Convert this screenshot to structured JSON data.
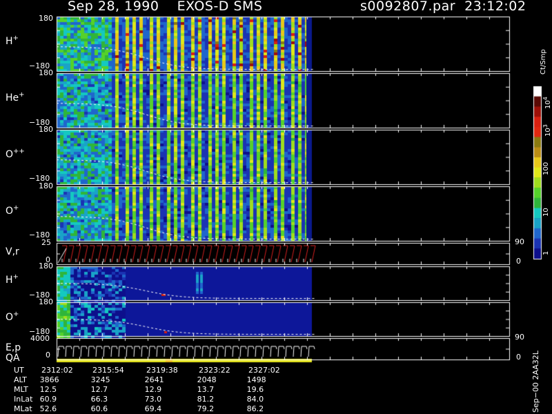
{
  "header": {
    "title_left": "Sep 28, 1990    EXOS-D SMS",
    "title_right": "s0092807.par  23:12:02"
  },
  "panels": [
    {
      "id": "h-plus-1",
      "label": "H",
      "sup": "+",
      "ymax": "180",
      "ymin": "−180"
    },
    {
      "id": "he-plus",
      "label": "He",
      "sup": "+",
      "ymax": "180",
      "ymin": "−180"
    },
    {
      "id": "o-plusplus",
      "label": "O",
      "sup": "++",
      "ymax": "180",
      "ymin": "−180"
    },
    {
      "id": "o-plus-1",
      "label": "O",
      "sup": "+",
      "ymax": "180",
      "ymin": "−180"
    },
    {
      "id": "vr",
      "label": "V,r",
      "sup": "",
      "ymax": "25",
      "ymin": "0",
      "rmax": "90",
      "rmin": "0"
    },
    {
      "id": "h-plus-2",
      "label": "H",
      "sup": "+",
      "ymax": "180",
      "ymin": "−180"
    },
    {
      "id": "o-plus-2",
      "label": "O",
      "sup": "+",
      "ymax": "180",
      "ymin": "−180"
    },
    {
      "id": "ep",
      "label": "E,p",
      "sup": "",
      "ymax": "4000",
      "ymin": "0",
      "rmax": "90",
      "rmin": "0"
    }
  ],
  "qa_label": "QA",
  "colorbar": {
    "units": "Ct/Smp",
    "ticks": [
      {
        "base": "10",
        "exp": "4"
      },
      {
        "base": "10",
        "exp": "3"
      },
      {
        "base": "100",
        "exp": ""
      },
      {
        "base": "10",
        "exp": ""
      },
      {
        "base": "1",
        "exp": ""
      }
    ],
    "tick_values": [
      10000,
      1000,
      100,
      10,
      1
    ]
  },
  "footer_note": "Sep−00  2AA32L",
  "table": {
    "rows": [
      {
        "name": "UT",
        "values": [
          "2312:02",
          "2315:54",
          "2319:38",
          "2323:22",
          "2327:02"
        ]
      },
      {
        "name": "ALT",
        "values": [
          "3866",
          "3245",
          "2641",
          "2048",
          "1498"
        ]
      },
      {
        "name": "MLT",
        "values": [
          "12.5",
          "12.7",
          "12.9",
          "13.7",
          "19.6"
        ]
      },
      {
        "name": "InLat",
        "values": [
          "60.9",
          "66.3",
          "73.0",
          "81.2",
          "84.0"
        ]
      },
      {
        "name": "MLat",
        "values": [
          "52.6",
          "60.6",
          "69.4",
          "79.2",
          "86.2"
        ]
      }
    ]
  },
  "chart_data": {
    "type": "heatmap",
    "title": "Sep 28, 1990    EXOS-D SMS",
    "x_ticks": [
      "2312:02",
      "2315:54",
      "2319:38",
      "2323:22",
      "2327:02"
    ],
    "scale": "log",
    "color_range": [
      1,
      10000
    ],
    "panels": [
      {
        "name": "H+",
        "ylim": [
          -180,
          180
        ]
      },
      {
        "name": "He+",
        "ylim": [
          -180,
          180
        ]
      },
      {
        "name": "O++",
        "ylim": [
          -180,
          180
        ]
      },
      {
        "name": "O+",
        "ylim": [
          -180,
          180
        ]
      },
      {
        "name": "V,r",
        "ylim": [
          0,
          25
        ],
        "right_ylim": [
          0,
          90
        ]
      },
      {
        "name": "H+",
        "ylim": [
          -180,
          180
        ]
      },
      {
        "name": "O+",
        "ylim": [
          -180,
          180
        ]
      },
      {
        "name": "E,p",
        "ylim": [
          0,
          4000
        ],
        "right_ylim": [
          0,
          90
        ]
      }
    ]
  }
}
